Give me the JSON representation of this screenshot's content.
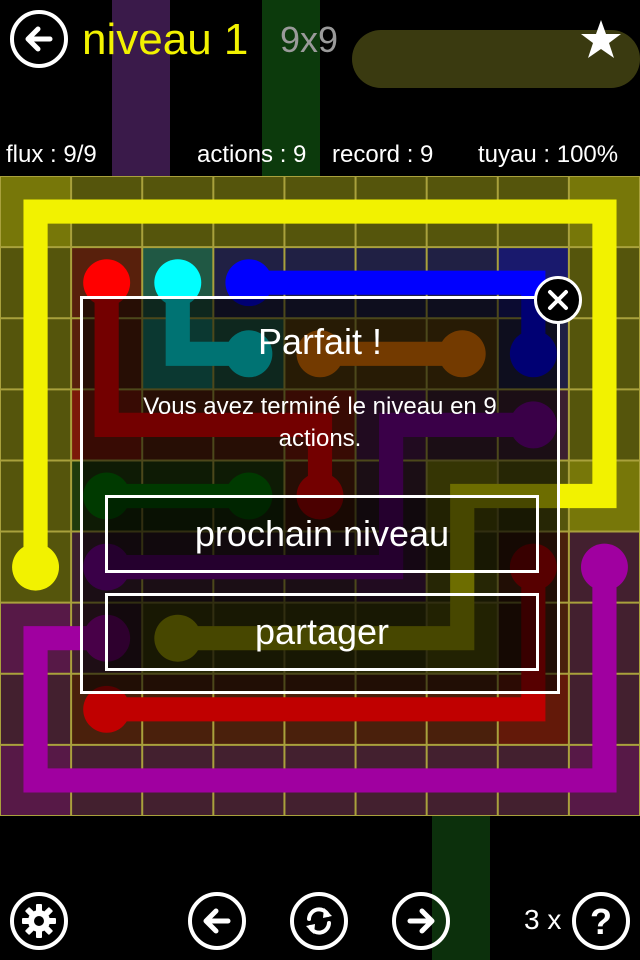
{
  "header": {
    "title": "niveau 1",
    "board_size": "9x9"
  },
  "stats": {
    "flows": "flux : 9/9",
    "moves": "actions : 9",
    "best": "record : 9",
    "pipe": "tuyau : 100%"
  },
  "board": {
    "rows": 9,
    "cols": 9,
    "grid_color": "#a9a13c",
    "flows": [
      {
        "color": "#f2f200",
        "name": "yellow",
        "path": [
          [
            0,
            5
          ],
          [
            0,
            0
          ],
          [
            8,
            0
          ],
          [
            8,
            4
          ],
          [
            6,
            4
          ],
          [
            6,
            6
          ],
          [
            2,
            6
          ]
        ]
      },
      {
        "color": "#ff0000",
        "name": "red",
        "path": [
          [
            1,
            1
          ],
          [
            1,
            3
          ],
          [
            4,
            3
          ],
          [
            4,
            4
          ]
        ]
      },
      {
        "color": "#00ffff",
        "name": "cyan",
        "path": [
          [
            2,
            1
          ],
          [
            2,
            2
          ],
          [
            3,
            2
          ]
        ]
      },
      {
        "color": "#0000ff",
        "name": "blue",
        "path": [
          [
            3,
            1
          ],
          [
            7,
            1
          ],
          [
            7,
            2
          ]
        ]
      },
      {
        "color": "#ff8000",
        "name": "orange",
        "path": [
          [
            4,
            2
          ],
          [
            6,
            2
          ]
        ]
      },
      {
        "color": "#8000a0",
        "name": "purple",
        "path": [
          [
            7,
            3
          ],
          [
            5,
            3
          ],
          [
            5,
            5
          ],
          [
            1,
            5
          ]
        ]
      },
      {
        "color": "#008000",
        "name": "green",
        "path": [
          [
            1,
            4
          ],
          [
            3,
            4
          ]
        ]
      },
      {
        "color": "#c00000",
        "name": "dark-red",
        "path": [
          [
            1,
            7
          ],
          [
            7,
            7
          ],
          [
            7,
            5
          ]
        ]
      },
      {
        "color": "#a000a0",
        "name": "magenta",
        "path": [
          [
            8,
            5
          ],
          [
            8,
            8
          ],
          [
            0,
            8
          ],
          [
            0,
            6
          ],
          [
            1,
            6
          ]
        ]
      }
    ]
  },
  "dialog": {
    "title": "Parfait !",
    "message": "Vous avez terminé le niveau en 9 actions.",
    "next_label": "prochain niveau",
    "share_label": "partager"
  },
  "footer": {
    "hints": "3 x"
  },
  "icons": {
    "back": "arrow-left-icon",
    "star": "star-icon",
    "close": "close-icon",
    "settings": "gear-icon",
    "previous": "arrow-left-icon",
    "reset": "refresh-icon",
    "next": "arrow-right-icon",
    "help": "question-icon"
  }
}
